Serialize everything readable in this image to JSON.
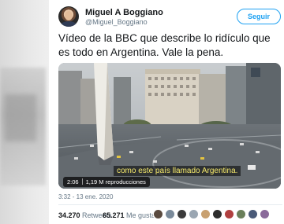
{
  "tweet": {
    "author": {
      "name": "Miguel A Boggiano",
      "handle": "@Miguel_Boggiano"
    },
    "follow_label": "Seguir",
    "text": "Vídeo de la BBC que describe lo ridículo que es todo en Argentina. Vale la pena.",
    "media": {
      "caption": "como este país llamado Argentina.",
      "duration": "2:06",
      "views": "1,19 M reproducciones"
    },
    "timestamp": "3:32 - 13 ene. 2020",
    "stats": {
      "retweets_count": "34.270",
      "retweets_label": "Retweets",
      "likes_count": "65.271",
      "likes_label": "Me gusta"
    }
  },
  "colors": {
    "accent": "#1da1f2",
    "text": "#14171a",
    "muted": "#657786",
    "caption": "#f5e96b"
  },
  "icons": [
    "avatar",
    "verified-none",
    "video-play"
  ]
}
